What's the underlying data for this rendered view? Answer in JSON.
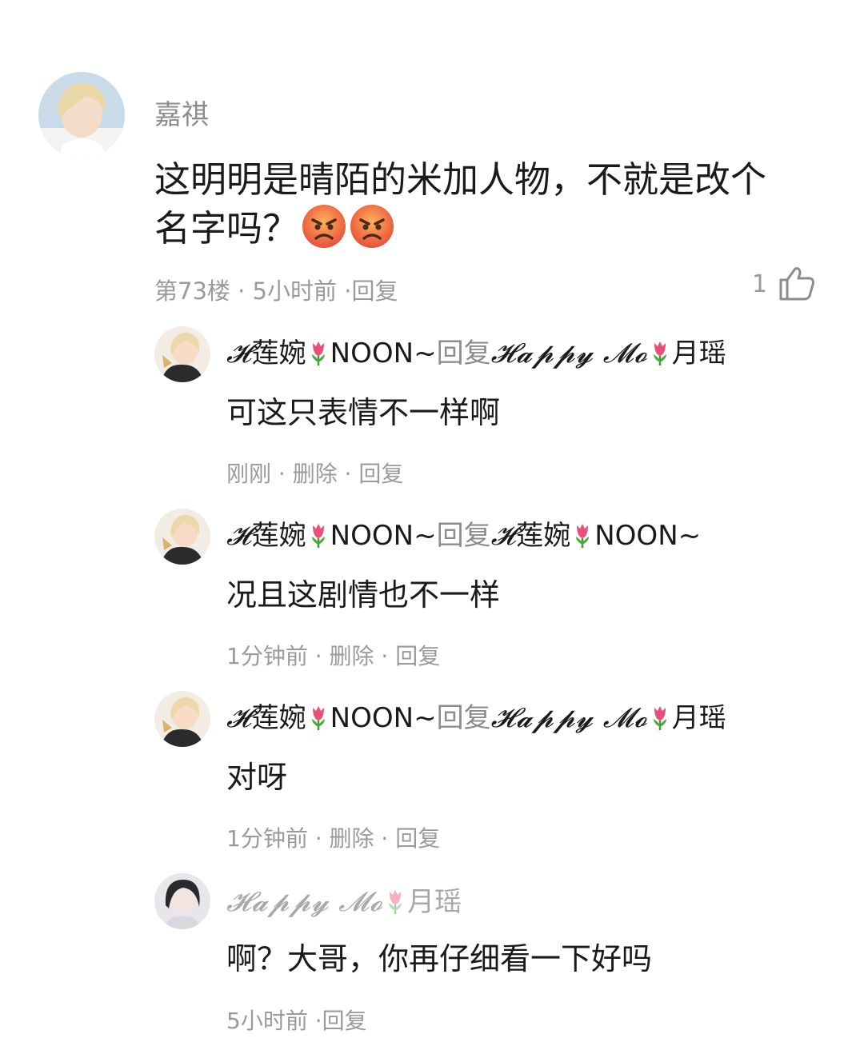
{
  "main_comment": {
    "username": "嘉祺",
    "text": "这明明是晴陌的米加人物，不就是改个名字吗？",
    "emojis": [
      "angry-face-icon",
      "angry-face-icon"
    ],
    "meta": "第73楼 · 5小时前 ·回复",
    "likes": "1"
  },
  "replies": [
    {
      "author_script": "𝓗",
      "author_name": "莲婉",
      "author_suffix": "NOON~",
      "reply_word": "回复",
      "target_script": "𝓗𝓪𝓹𝓹𝔂 𝓜𝓸",
      "target_name": "月瑶",
      "text": "可这只表情不一样啊",
      "meta": "刚刚 · 删除 · 回复"
    },
    {
      "author_script": "𝓗",
      "author_name": "莲婉",
      "author_suffix": "NOON~",
      "reply_word": "回复",
      "target_script": "𝓗",
      "target_name": "莲婉",
      "target_suffix": "NOON~",
      "text": "况且这剧情也不一样",
      "meta": "1分钟前 · 删除 · 回复"
    },
    {
      "author_script": "𝓗",
      "author_name": "莲婉",
      "author_suffix": "NOON~",
      "reply_word": "回复",
      "target_script": "𝓗𝓪𝓹𝓹𝔂 𝓜𝓸",
      "target_name": "月瑶",
      "text": "对呀",
      "meta": "1分钟前 · 删除 · 回复"
    },
    {
      "author_script": "𝓗𝓪𝓹𝓹𝔂 𝓜𝓸",
      "author_name": "月瑶",
      "text": "啊？大哥，你再仔细看一下好吗",
      "meta": "5小时前 ·回复"
    }
  ],
  "colors": {
    "text": "#1a1a1a",
    "muted": "#9a9a9a",
    "tulip": "#e8507a",
    "leaf": "#3a9a3a",
    "angry": "#e8503a"
  }
}
